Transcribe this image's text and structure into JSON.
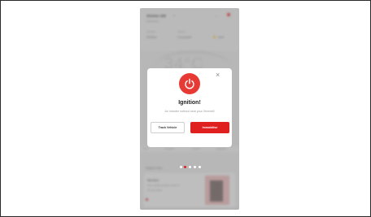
{
  "background": {
    "vehicle_name": "Xtreme 160",
    "vehicle_sub": "Maintained ...",
    "header_stats": [
      {
        "label": "Odometer",
        "value": "8304km"
      },
      {
        "label": "Network",
        "value": "Connected"
      },
      {
        "label": "Weather",
        "value": "Next"
      }
    ],
    "speed_reading": "34°C",
    "tabs": [
      "Home",
      "Immobiliser",
      "Geofence",
      "Diagnostics"
    ],
    "explore_title": "Explore Hero",
    "card": {
      "title": "Service",
      "subtitle": "Your vehicle service is due on",
      "date": "18 July, 2023",
      "link": "Book Now"
    }
  },
  "dialog": {
    "icon": "power-icon",
    "title": "Ignition!",
    "message": "An intruder noticed near your Xtreme8",
    "track_button": "Track Vehicle",
    "immobilise_button": "Immobilise",
    "close_icon": "close-icon"
  },
  "pager": {
    "count": 5,
    "active_index": 1
  },
  "colors": {
    "accent": "#e01f1f",
    "power_circle": "#e83a35"
  }
}
